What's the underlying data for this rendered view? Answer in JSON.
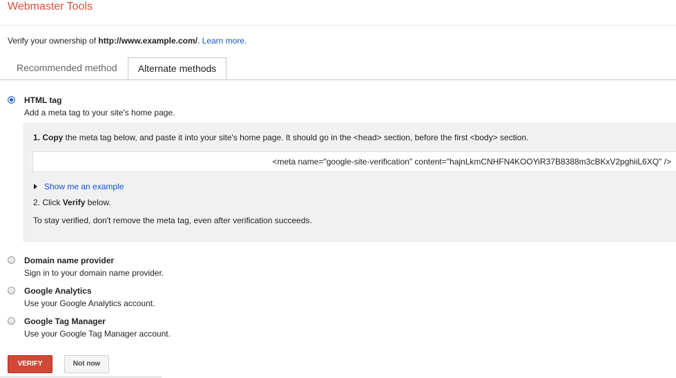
{
  "header": {
    "app_title": "Webmaster Tools"
  },
  "verify": {
    "prefix": "Verify your ownership of ",
    "url": "http://www.example.com/",
    "suffix": ". ",
    "learn_more": "Learn more."
  },
  "tabs": [
    {
      "label": "Recommended method",
      "active": false
    },
    {
      "label": "Alternate methods",
      "active": true
    }
  ],
  "options": [
    {
      "title": "HTML tag",
      "description": "Add a meta tag to your site's home page.",
      "selected": true
    },
    {
      "title": "Domain name provider",
      "description": "Sign in to your domain name provider.",
      "selected": false
    },
    {
      "title": "Google Analytics",
      "description": "Use your Google Analytics account.",
      "selected": false
    },
    {
      "title": "Google Tag Manager",
      "description": "Use your Google Tag Manager account.",
      "selected": false
    }
  ],
  "panel": {
    "step1_bold": "1. Copy",
    "step1_rest": " the meta tag below, and paste it into your site's home page. It should go in the <head> section, before the first <body> section.",
    "meta_tag": "<meta name=\"google-site-verification\" content=\"hajnLkmCNHFN4KOOYiR37B8388m3cBKxV2pghiiL6XQ\" />",
    "show_example": "Show me an example",
    "step2_prefix": "2. Click ",
    "step2_bold": "Verify",
    "step2_suffix": " below.",
    "stay_note": "To stay verified, don't remove the meta tag, even after verification succeeds."
  },
  "buttons": {
    "verify": "VERIFY",
    "not_now": "Not now"
  },
  "colors": {
    "title_red": "#dd4b39",
    "link_blue": "#1155cc",
    "verify_button": "#d14836"
  }
}
